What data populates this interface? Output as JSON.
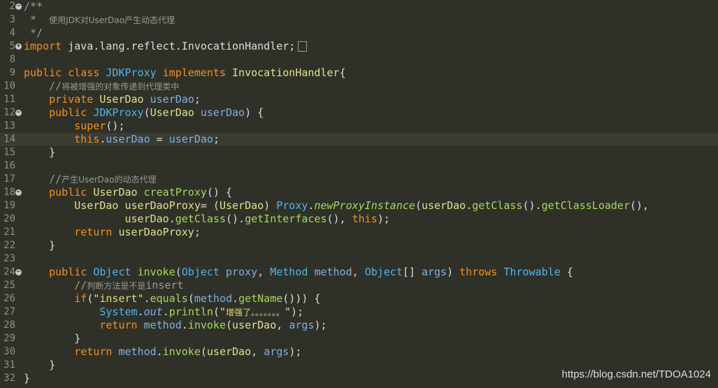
{
  "editor": {
    "lines": [
      {
        "num": "2",
        "segments": [
          [
            "cmt",
            "/**"
          ]
        ],
        "fold": "−"
      },
      {
        "num": "3",
        "segments": [
          [
            "cmt",
            " *  "
          ],
          [
            "cmt zh",
            "使用JDK对UserDao产生动态代理"
          ]
        ]
      },
      {
        "num": "4",
        "segments": [
          [
            "cmt",
            " */"
          ]
        ]
      },
      {
        "num": "5",
        "segments": [
          [
            "kw",
            "import"
          ],
          [
            "plain",
            " java.lang.reflect.InvocationHandler;"
          ]
        ],
        "fold": "+",
        "folded": true
      },
      {
        "num": "8",
        "segments": []
      },
      {
        "num": "9",
        "segments": [
          [
            "kw",
            "public class "
          ],
          [
            "typ",
            "JDKProxy "
          ],
          [
            "kw",
            "implements "
          ],
          [
            "cls",
            "InvocationHandler"
          ],
          [
            "plain",
            "{"
          ]
        ]
      },
      {
        "num": "10",
        "segments": [
          [
            "cmt",
            "    //"
          ],
          [
            "cmt zh",
            "将被增强的对象传递到代理类中"
          ]
        ]
      },
      {
        "num": "11",
        "segments": [
          [
            "kw",
            "    private "
          ],
          [
            "cls",
            "UserDao "
          ],
          [
            "var",
            "userDao"
          ],
          [
            "plain",
            ";"
          ]
        ]
      },
      {
        "num": "12",
        "segments": [
          [
            "kw",
            "    public "
          ],
          [
            "typ",
            "JDKProxy"
          ],
          [
            "plain",
            "("
          ],
          [
            "cls",
            "UserDao "
          ],
          [
            "var",
            "userDao"
          ],
          [
            "plain",
            ") {"
          ]
        ],
        "fold": "−"
      },
      {
        "num": "13",
        "segments": [
          [
            "kw",
            "        super"
          ],
          [
            "plain",
            "();"
          ]
        ]
      },
      {
        "num": "14",
        "segments": [
          [
            "kw",
            "        this"
          ],
          [
            "plain",
            "."
          ],
          [
            "var",
            "userDao"
          ],
          [
            "plain",
            " = "
          ],
          [
            "var",
            "userDao"
          ],
          [
            "plain",
            ";"
          ]
        ],
        "current": true
      },
      {
        "num": "15",
        "segments": [
          [
            "plain",
            "    }"
          ]
        ]
      },
      {
        "num": "16",
        "segments": []
      },
      {
        "num": "17",
        "segments": [
          [
            "cmt",
            "    //"
          ],
          [
            "cmt zh",
            "产生UserDao的动态代理"
          ]
        ]
      },
      {
        "num": "18",
        "segments": [
          [
            "kw",
            "    public "
          ],
          [
            "cls",
            "UserDao "
          ],
          [
            "fn",
            "creatProxy"
          ],
          [
            "plain",
            "() {"
          ]
        ],
        "fold": "−"
      },
      {
        "num": "19",
        "segments": [
          [
            "cls",
            "        UserDao "
          ],
          [
            "cls",
            "userDaoProxy"
          ],
          [
            "plain",
            "= ("
          ],
          [
            "cls",
            "UserDao"
          ],
          [
            "plain",
            ") "
          ],
          [
            "typ",
            "Proxy"
          ],
          [
            "plain",
            "."
          ],
          [
            "mth itl",
            "newProxyInstance"
          ],
          [
            "plain",
            "("
          ],
          [
            "cls",
            "userDao"
          ],
          [
            "plain",
            "."
          ],
          [
            "fn",
            "getClass"
          ],
          [
            "plain",
            "()."
          ],
          [
            "fn",
            "getClassLoader"
          ],
          [
            "plain",
            "(),"
          ]
        ]
      },
      {
        "num": "20",
        "segments": [
          [
            "cls",
            "                userDao"
          ],
          [
            "plain",
            "."
          ],
          [
            "fn",
            "getClass"
          ],
          [
            "plain",
            "()."
          ],
          [
            "fn",
            "getInterfaces"
          ],
          [
            "plain",
            "(), "
          ],
          [
            "kw",
            "this"
          ],
          [
            "plain",
            ");"
          ]
        ]
      },
      {
        "num": "21",
        "segments": [
          [
            "kw",
            "        return "
          ],
          [
            "cls",
            "userDaoProxy"
          ],
          [
            "plain",
            ";"
          ]
        ]
      },
      {
        "num": "22",
        "segments": [
          [
            "plain",
            "    }"
          ]
        ]
      },
      {
        "num": "23",
        "segments": []
      },
      {
        "num": "24",
        "segments": [
          [
            "kw",
            "    public "
          ],
          [
            "typ",
            "Object "
          ],
          [
            "fn",
            "invoke"
          ],
          [
            "plain",
            "("
          ],
          [
            "typ",
            "Object "
          ],
          [
            "var",
            "proxy"
          ],
          [
            "plain",
            ", "
          ],
          [
            "typ",
            "Method "
          ],
          [
            "var",
            "method"
          ],
          [
            "plain",
            ", "
          ],
          [
            "typ",
            "Object"
          ],
          [
            "plain",
            "[] "
          ],
          [
            "var",
            "args"
          ],
          [
            "plain",
            ") "
          ],
          [
            "kw",
            "throws "
          ],
          [
            "typ",
            "Throwable "
          ],
          [
            "plain",
            "{"
          ]
        ],
        "fold": "−"
      },
      {
        "num": "25",
        "segments": [
          [
            "cmt",
            "        //"
          ],
          [
            "cmt zh",
            "判断方法是不是"
          ],
          [
            "cmt",
            "insert"
          ]
        ]
      },
      {
        "num": "26",
        "segments": [
          [
            "kw",
            "        if"
          ],
          [
            "plain",
            "("
          ],
          [
            "str",
            "\"insert\""
          ],
          [
            "plain",
            "."
          ],
          [
            "fn",
            "equals"
          ],
          [
            "plain",
            "("
          ],
          [
            "var",
            "method"
          ],
          [
            "plain",
            "."
          ],
          [
            "fn",
            "getName"
          ],
          [
            "plain",
            "())) {"
          ]
        ]
      },
      {
        "num": "27",
        "segments": [
          [
            "typ",
            "            System"
          ],
          [
            "plain",
            "."
          ],
          [
            "var itl",
            "out"
          ],
          [
            "plain",
            "."
          ],
          [
            "fn",
            "println"
          ],
          [
            "plain",
            "("
          ],
          [
            "str",
            "\""
          ],
          [
            "str zh",
            "增强了。。。。。。。"
          ],
          [
            "str",
            "\""
          ],
          [
            "plain",
            ");"
          ]
        ]
      },
      {
        "num": "28",
        "segments": [
          [
            "kw",
            "            return "
          ],
          [
            "var",
            "method"
          ],
          [
            "plain",
            "."
          ],
          [
            "fn",
            "invoke"
          ],
          [
            "plain",
            "("
          ],
          [
            "cls",
            "userDao"
          ],
          [
            "plain",
            ", "
          ],
          [
            "var",
            "args"
          ],
          [
            "plain",
            ");"
          ]
        ]
      },
      {
        "num": "29",
        "segments": [
          [
            "plain",
            "        }"
          ]
        ]
      },
      {
        "num": "30",
        "segments": [
          [
            "kw",
            "        return "
          ],
          [
            "var",
            "method"
          ],
          [
            "plain",
            "."
          ],
          [
            "fn",
            "invoke"
          ],
          [
            "plain",
            "("
          ],
          [
            "cls",
            "userDao"
          ],
          [
            "plain",
            ", "
          ],
          [
            "var",
            "args"
          ],
          [
            "plain",
            ");"
          ]
        ]
      },
      {
        "num": "31",
        "segments": [
          [
            "plain",
            "    }"
          ]
        ]
      },
      {
        "num": "32",
        "segments": [
          [
            "plain",
            "}"
          ]
        ]
      }
    ]
  },
  "watermark": "https://blog.csdn.net/TDOA1024"
}
